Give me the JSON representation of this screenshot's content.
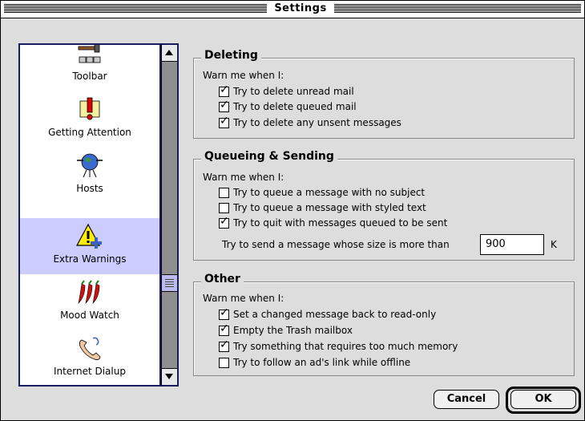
{
  "window": {
    "title": "Settings"
  },
  "sidebar": {
    "items": [
      {
        "label": "Toolbar",
        "icon": "hammer-toolbar-icon"
      },
      {
        "label": "Getting Attention",
        "icon": "exclamation-icon"
      },
      {
        "label": "Hosts",
        "icon": "globe-network-icon"
      },
      {
        "label": "Extra Warnings",
        "icon": "warning-triangle-icon",
        "selected": true
      },
      {
        "label": "Mood Watch",
        "icon": "chili-peppers-icon"
      },
      {
        "label": "Internet Dialup",
        "icon": "telephone-icon"
      }
    ]
  },
  "deleting": {
    "title": "Deleting",
    "warn_label": "Warn me when I:",
    "options": [
      {
        "label": "Try to delete unread mail",
        "checked": true
      },
      {
        "label": "Try to delete queued mail",
        "checked": true
      },
      {
        "label": "Try to delete any unsent messages",
        "checked": true
      }
    ]
  },
  "queueing": {
    "title": "Queueing & Sending",
    "warn_label": "Warn me when I:",
    "options": [
      {
        "label": "Try to queue a message with no subject",
        "checked": false
      },
      {
        "label": "Try to queue a message with styled text",
        "checked": false
      },
      {
        "label": "Try to quit with messages queued to be sent",
        "checked": true
      }
    ],
    "size_label": "Try to send a message whose size is more than",
    "size_value": "900",
    "size_unit": "K"
  },
  "other": {
    "title": "Other",
    "warn_label": "Warn me when I:",
    "options": [
      {
        "label": "Set a changed message back to read-only",
        "checked": true
      },
      {
        "label": "Empty the Trash mailbox",
        "checked": true
      },
      {
        "label": "Try something that requires too much memory",
        "checked": true
      },
      {
        "label": "Try to follow an ad's link while offline",
        "checked": false
      }
    ]
  },
  "buttons": {
    "cancel": "Cancel",
    "ok": "OK"
  },
  "colors": {
    "selection": "#ccccff",
    "list_border": "#1a1a60",
    "window_bg": "#dddddd"
  }
}
